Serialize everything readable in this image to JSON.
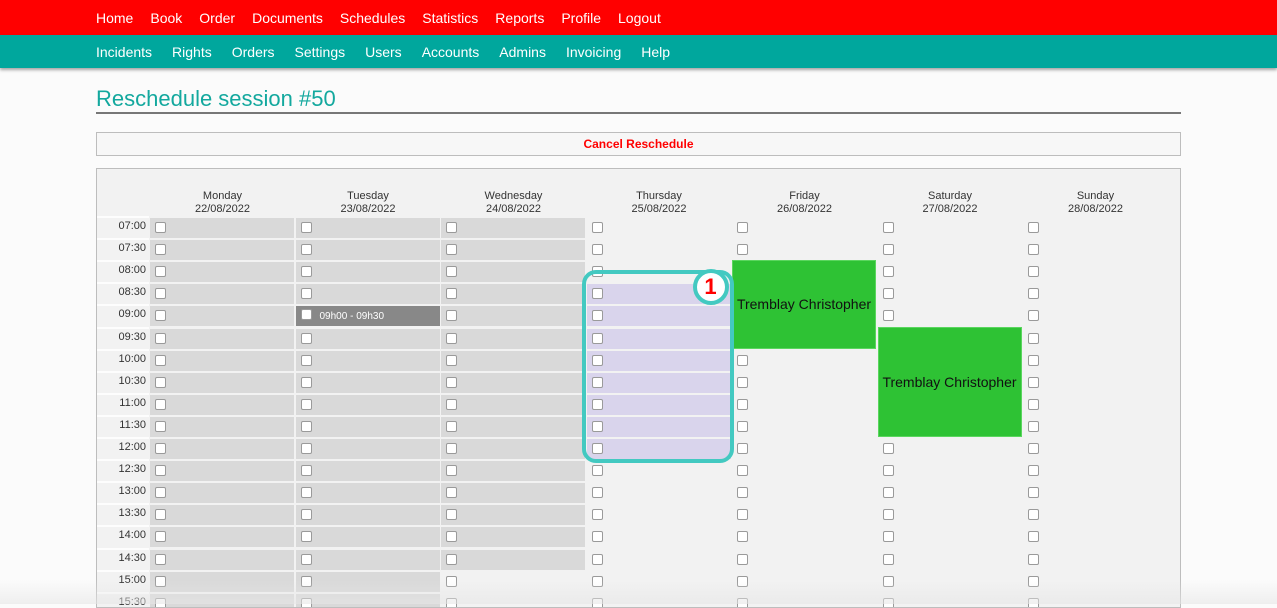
{
  "nav_top": [
    "Home",
    "Book",
    "Order",
    "Documents",
    "Schedules",
    "Statistics",
    "Reports",
    "Profile",
    "Logout"
  ],
  "nav_sub": [
    "Incidents",
    "Rights",
    "Orders",
    "Settings",
    "Users",
    "Accounts",
    "Admins",
    "Invoicing",
    "Help"
  ],
  "page_title": "Reschedule session #50",
  "cancel_label": "Cancel Reschedule",
  "colors": {
    "nav_top": "#ff0000",
    "nav_sub": "#00a79d",
    "title": "#13a89e",
    "booked_green": "#2ec234",
    "highlight": "#d9d4ec",
    "annotation": "#43c9c1"
  },
  "days": [
    {
      "name": "Monday",
      "date": "22/08/2022",
      "grey_until": "15:30"
    },
    {
      "name": "Tuesday",
      "date": "23/08/2022",
      "grey_until": "15:30"
    },
    {
      "name": "Wednesday",
      "date": "24/08/2022",
      "grey_until": "14:30"
    },
    {
      "name": "Thursday",
      "date": "25/08/2022",
      "grey_until": null
    },
    {
      "name": "Friday",
      "date": "26/08/2022",
      "grey_until": null
    },
    {
      "name": "Saturday",
      "date": "27/08/2022",
      "grey_until": null
    },
    {
      "name": "Sunday",
      "date": "28/08/2022",
      "grey_until": null
    }
  ],
  "times": [
    "07:00",
    "07:30",
    "08:00",
    "08:30",
    "09:00",
    "09:30",
    "10:00",
    "10:30",
    "11:00",
    "11:30",
    "12:00",
    "12:30",
    "13:00",
    "13:30",
    "14:00",
    "14:30",
    "15:00",
    "15:30"
  ],
  "current_session": {
    "day": "Tuesday",
    "start": "09:00",
    "label": "09h00 - 09h30"
  },
  "highlight": {
    "day": "Thursday",
    "start": "08:30",
    "end": "12:00"
  },
  "bookings": [
    {
      "day": "Friday",
      "start": "08:00",
      "end": "09:30",
      "label": "Tremblay Christopher"
    },
    {
      "day": "Saturday",
      "start": "09:30",
      "end": "11:30",
      "label": "Tremblay Christopher"
    }
  ],
  "annotation": {
    "number": "1"
  }
}
